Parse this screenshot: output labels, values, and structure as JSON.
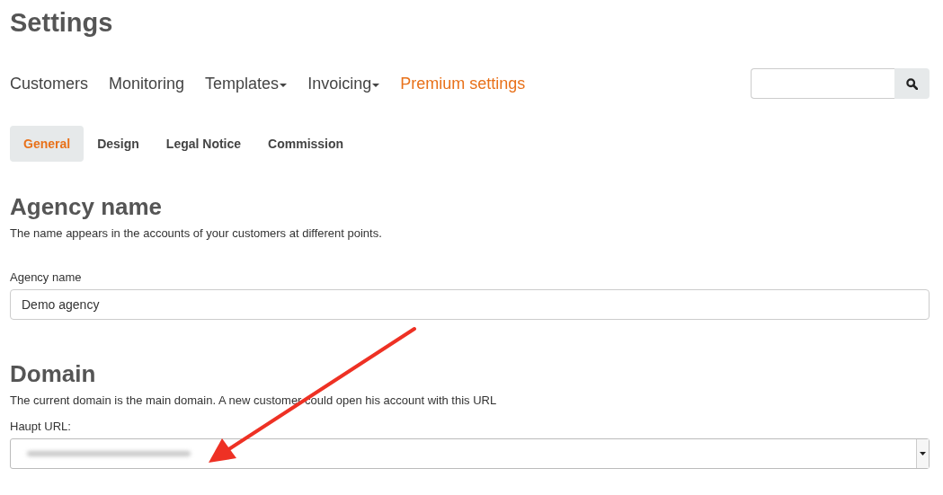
{
  "page_title": "Settings",
  "nav": [
    {
      "label": "Customers",
      "kind": "link",
      "selected": false
    },
    {
      "label": "Monitoring",
      "kind": "link",
      "selected": false
    },
    {
      "label": "Templates",
      "kind": "dropdown",
      "selected": false
    },
    {
      "label": "Invoicing",
      "kind": "dropdown",
      "selected": false
    },
    {
      "label": "Premium settings",
      "kind": "link",
      "selected": true
    }
  ],
  "tabs": [
    {
      "label": "General",
      "selected": true
    },
    {
      "label": "Design",
      "selected": false
    },
    {
      "label": "Legal Notice",
      "selected": false
    },
    {
      "label": "Commission",
      "selected": false
    }
  ],
  "sections": [
    {
      "heading": "Agency name",
      "description": "The name appears in the accounts of your customers at different points.",
      "field": {
        "kind": "input",
        "label": "Agency name",
        "value": "Demo agency"
      }
    },
    {
      "heading": "Domain",
      "description": "The current domain is the main domain. A new customer could open his account with this URL",
      "field": {
        "kind": "select",
        "label": "Haupt URL:"
      }
    }
  ]
}
